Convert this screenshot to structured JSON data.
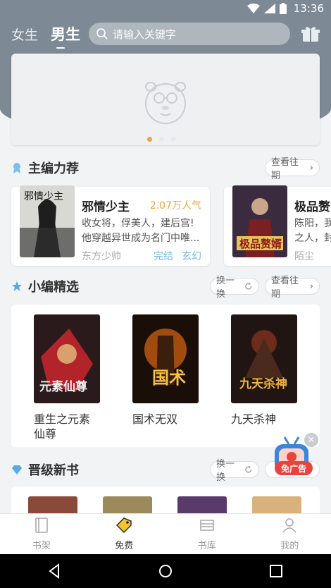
{
  "status": {
    "time": "13:36"
  },
  "header": {
    "tabs": [
      {
        "label": "女生"
      },
      {
        "label": "男生"
      }
    ],
    "search_placeholder": "请输入关键字"
  },
  "sections": {
    "editor_pick": {
      "title": "主编力荐",
      "history": "查看往期"
    },
    "small_pick": {
      "title": "小编精选",
      "refresh": "换一换",
      "history": "查看往期"
    },
    "upgrade": {
      "title": "晋级新书",
      "refresh": "换一换"
    }
  },
  "featured": [
    {
      "title": "邪情少主",
      "popularity": "2.07万人气",
      "desc": "收女将，俘美人，建后宫!他穿越异世成为名门中唯...",
      "author": "东方少帅",
      "tags": [
        "完结",
        "玄幻"
      ]
    },
    {
      "title": "极品赘",
      "desc": "陈阳，我之人，封",
      "author": "陌尘"
    }
  ],
  "picks": [
    {
      "title": "重生之元素仙尊"
    },
    {
      "title": "国术无双"
    },
    {
      "title": "九天杀神"
    }
  ],
  "ad": {
    "label": "免广告"
  },
  "nav": [
    {
      "label": "书架",
      "icon": "bookshelf-icon"
    },
    {
      "label": "免费",
      "icon": "free-tag-icon"
    },
    {
      "label": "书库",
      "icon": "library-icon"
    },
    {
      "label": "我的",
      "icon": "profile-icon"
    }
  ],
  "colors": {
    "header": "#7d8a95",
    "accent": "#f0a43a",
    "tag": "#73b8e0"
  }
}
